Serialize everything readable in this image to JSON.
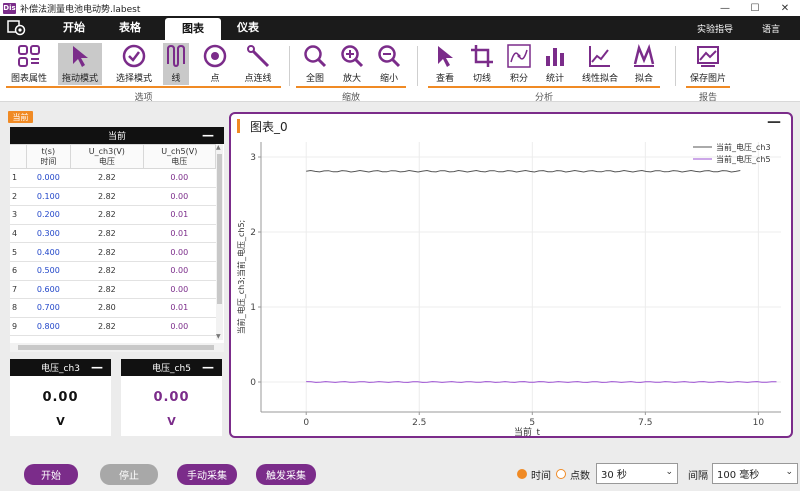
{
  "window": {
    "logo": "Dis",
    "title": "补偿法测量电池电动势.labest"
  },
  "menu": {
    "tabs": [
      "开始",
      "表格",
      "图表",
      "仪表"
    ],
    "active_tab": "图表",
    "right_items": [
      "实验指导",
      "语言"
    ]
  },
  "ribbon": {
    "options": {
      "label": "选项",
      "buttons": [
        "图表属性",
        "拖动模式",
        "选择模式",
        "线",
        "点",
        "点连线"
      ]
    },
    "zoom": {
      "label": "缩放",
      "buttons": [
        "全图",
        "放大",
        "缩小"
      ]
    },
    "analysis": {
      "label": "分析",
      "buttons": [
        "查看",
        "切线",
        "积分",
        "统计",
        "线性拟合",
        "拟合"
      ]
    },
    "report": {
      "label": "报告",
      "buttons": [
        "保存图片"
      ]
    }
  },
  "current_badge": "当前",
  "table": {
    "title": "当前",
    "headers": [
      {
        "line1": "t(s)",
        "line2": "时间"
      },
      {
        "line1": "U_ch3(V)",
        "line2": "电压"
      },
      {
        "line1": "U_ch5(V)",
        "line2": "电压"
      }
    ],
    "rows": [
      [
        "1",
        "0.000",
        "2.82",
        "0.00"
      ],
      [
        "2",
        "0.100",
        "2.82",
        "0.00"
      ],
      [
        "3",
        "0.200",
        "2.82",
        "0.01"
      ],
      [
        "4",
        "0.300",
        "2.82",
        "0.01"
      ],
      [
        "5",
        "0.400",
        "2.82",
        "0.00"
      ],
      [
        "6",
        "0.500",
        "2.82",
        "0.00"
      ],
      [
        "7",
        "0.600",
        "2.82",
        "0.00"
      ],
      [
        "8",
        "0.700",
        "2.80",
        "0.01"
      ],
      [
        "9",
        "0.800",
        "2.82",
        "0.00"
      ]
    ]
  },
  "meters": [
    {
      "title": "电压_ch3",
      "value": "0.00",
      "unit": "V",
      "color": "#111111"
    },
    {
      "title": "电压_ch5",
      "value": "0.00",
      "unit": "V",
      "color": "#7b2c8a"
    }
  ],
  "chart_panel": {
    "title": "图表_0"
  },
  "chart_data": {
    "type": "line",
    "xlabel": "当前_t",
    "ylabel": "当前_电压_ch3;当前_电压_ch5;",
    "xlim": [
      -1.0,
      10.5
    ],
    "ylim": [
      -0.4,
      3.2
    ],
    "x_ticks": [
      "0",
      "2.5",
      "5",
      "7.5",
      "10"
    ],
    "y_ticks": [
      "0",
      "1",
      "2",
      "3"
    ],
    "grid": true,
    "legend_position": "top-right",
    "series": [
      {
        "name": "当前_电压_ch3",
        "color": "#555555",
        "x_range": [
          0,
          9.6
        ],
        "value": 2.81,
        "jitter": 0.01
      },
      {
        "name": "当前_电压_ch5",
        "color": "#9a4fd0",
        "x_range": [
          0,
          10.4
        ],
        "value": 0.0,
        "jitter": 0.006
      }
    ]
  },
  "bottom": {
    "start": "开始",
    "stop": "停止",
    "manual": "手动采集",
    "trigger": "触发采集",
    "mode_time": "时间",
    "mode_points": "点数",
    "duration": "30 秒",
    "interval_label": "间隔",
    "interval": "100 毫秒"
  }
}
